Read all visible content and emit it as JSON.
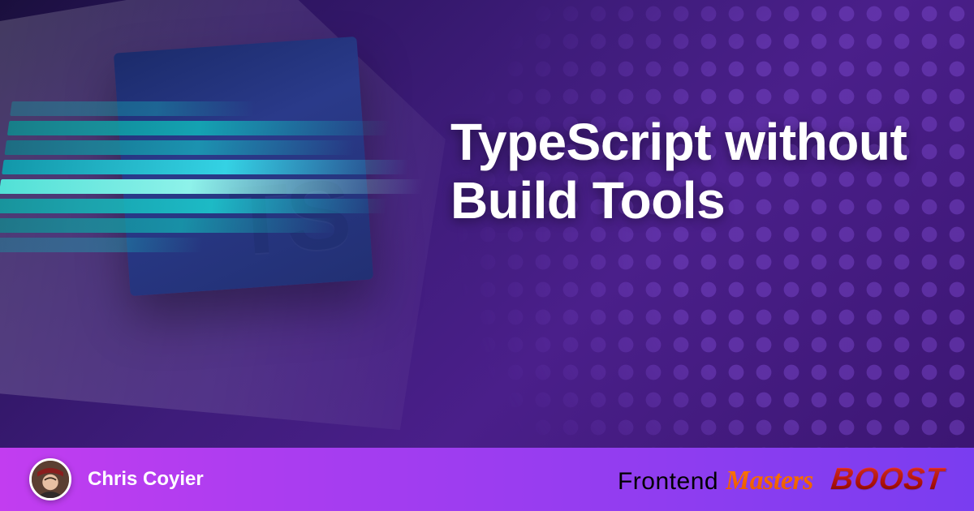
{
  "hero": {
    "title": "TypeScript without Build Tools",
    "logo_letters": "TS"
  },
  "footer": {
    "author_name": "Chris Coyier",
    "brand_frontend": "Frontend",
    "brand_masters": "Masters",
    "brand_boost": "BOOST"
  },
  "colors": {
    "bg_start": "#1a0f3d",
    "bg_end": "#3a1570",
    "footer_start": "#c23df0",
    "footer_end": "#7a3df0",
    "accent_orange": "#ff7a00",
    "accent_red": "#ff3b2f"
  }
}
